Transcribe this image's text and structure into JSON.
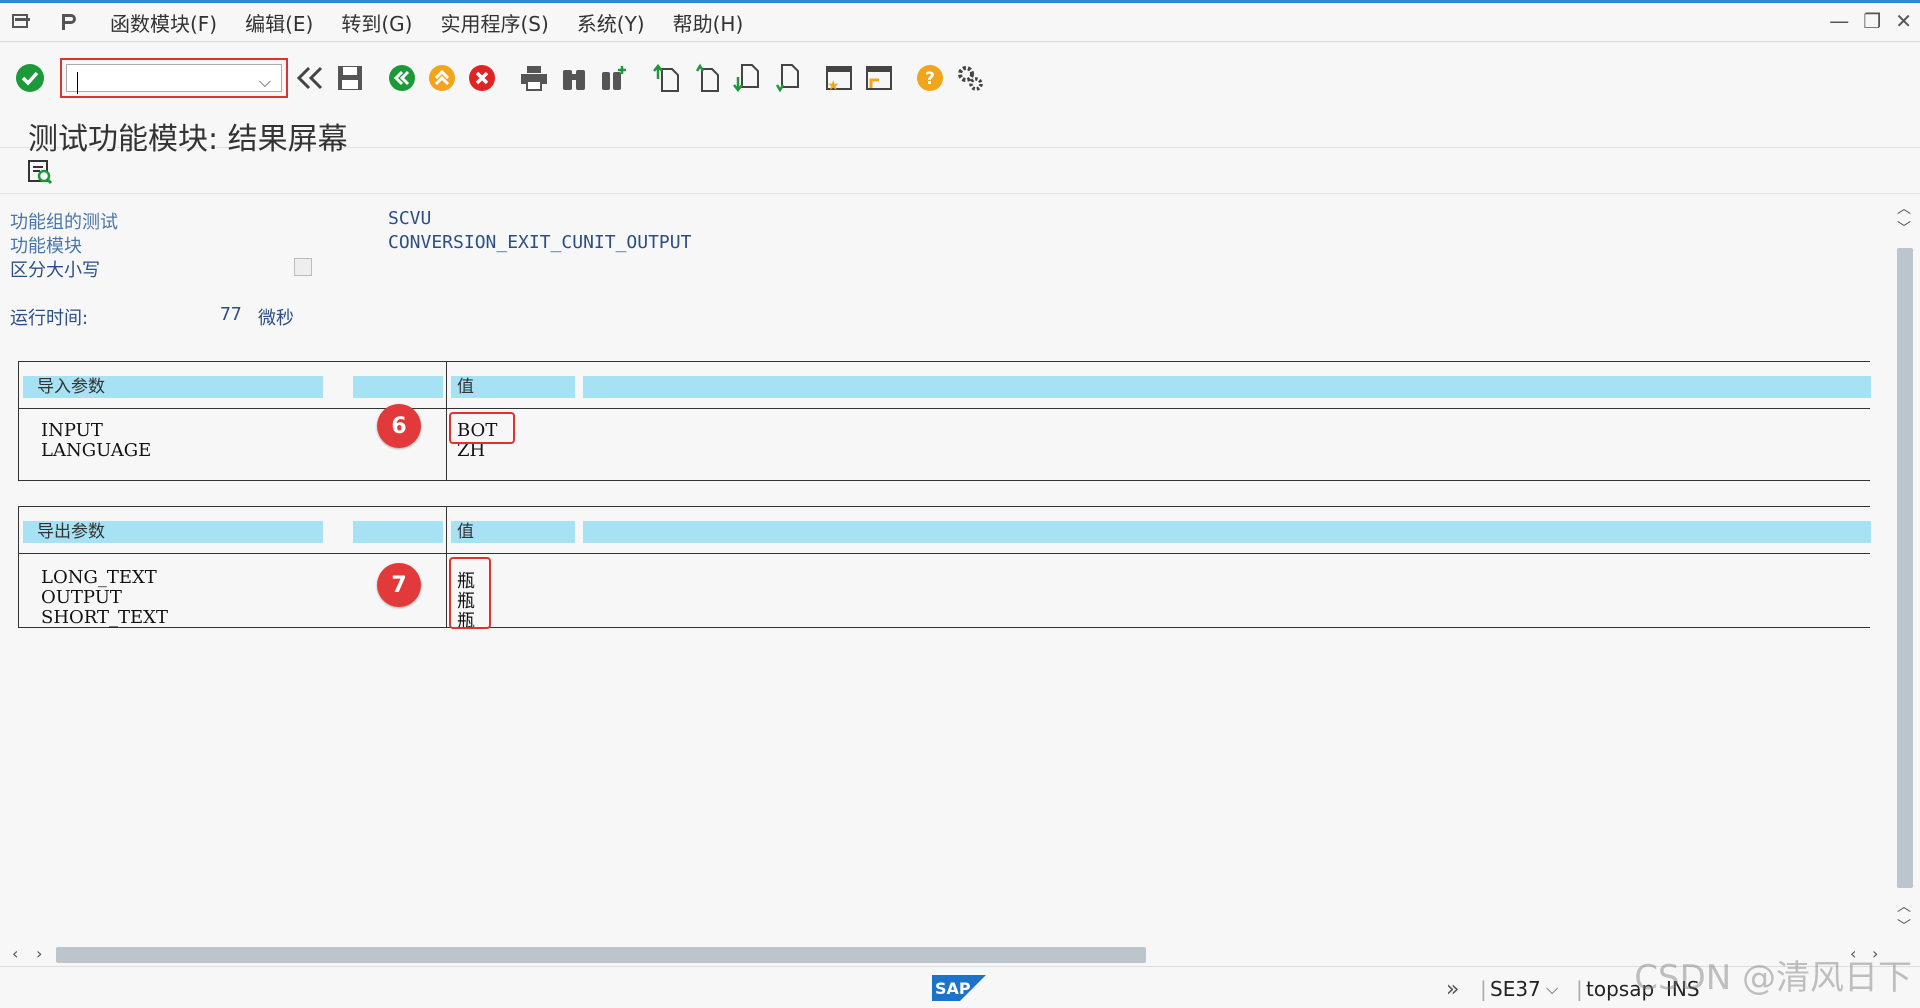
{
  "menu": {
    "items": [
      "函数模块(F)",
      "编辑(E)",
      "转到(G)",
      "实用程序(S)",
      "系统(Y)",
      "帮助(H)"
    ]
  },
  "toolbar": {
    "command_value": ""
  },
  "page": {
    "title": "测试功能模块: 结果屏幕"
  },
  "info": {
    "group_label": "功能组的测试",
    "group_value": "SCVU",
    "module_label": "功能模块",
    "module_value": "CONVERSION_EXIT_CUNIT_OUTPUT",
    "case_label": "区分大小写",
    "runtime_label": "运行时间:",
    "runtime_value": "77",
    "runtime_unit": "微秒"
  },
  "import_params": {
    "header": "导入参数",
    "value_header": "值",
    "rows": [
      {
        "name": "INPUT",
        "value": "BOT"
      },
      {
        "name": "LANGUAGE",
        "value": "ZH"
      }
    ],
    "badge": "6"
  },
  "export_params": {
    "header": "导出参数",
    "value_header": "值",
    "rows": [
      {
        "name": "LONG_TEXT",
        "value": "瓶"
      },
      {
        "name": "OUTPUT",
        "value": "瓶"
      },
      {
        "name": "SHORT_TEXT",
        "value": "瓶"
      }
    ],
    "badge": "7"
  },
  "status": {
    "transaction": "SE37",
    "system": "topsap",
    "mode": "INS"
  },
  "watermark": "CSDN @清风日下",
  "colors": {
    "accent_blue": "#2a8ad4",
    "header_cyan": "#a6e1f4",
    "badge_red": "#e23a3a",
    "highlight_red": "#d33333"
  }
}
